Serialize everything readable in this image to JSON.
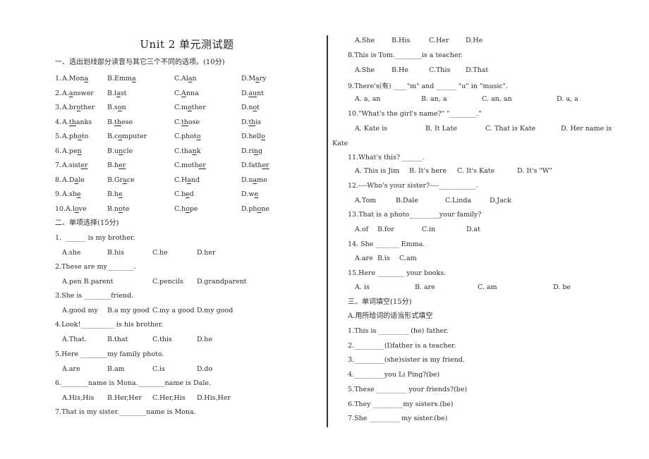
{
  "title": "Unit  2 单元测试题",
  "section1": {
    "heading": "一、选出划线部分读音与其它三个不同的选项。(10分)",
    "rows": [
      {
        "num": "1.",
        "options": [
          {
            "label": "A.",
            "pre": "Mon",
            "u": "a",
            "post": ""
          },
          {
            "label": "B.",
            "pre": "Emm",
            "u": "a",
            "post": ""
          },
          {
            "label": "C.",
            "pre": "Al",
            "u": "a",
            "post": "n"
          },
          {
            "label": "D.",
            "pre": "M",
            "u": "a",
            "post": "ry"
          }
        ]
      },
      {
        "num": "2.",
        "options": [
          {
            "label": "A.",
            "pre": "",
            "u": "a",
            "post": "nswer"
          },
          {
            "label": "B.",
            "pre": "l",
            "u": "a",
            "post": "st"
          },
          {
            "label": "C.",
            "pre": "",
            "u": "A",
            "post": "nna"
          },
          {
            "label": "D.",
            "pre": "",
            "u": "au",
            "post": "nt"
          }
        ]
      },
      {
        "num": "3.",
        "options": [
          {
            "label": "A.",
            "pre": "br",
            "u": "o",
            "post": "ther"
          },
          {
            "label": "B.",
            "pre": "s",
            "u": "o",
            "post": "n"
          },
          {
            "label": "C.",
            "pre": "m",
            "u": "o",
            "post": "ther"
          },
          {
            "label": "D.",
            "pre": "n",
            "u": "o",
            "post": "t"
          }
        ]
      },
      {
        "num": "4.",
        "options": [
          {
            "label": "A.",
            "pre": "",
            "u": "th",
            "post": "anks"
          },
          {
            "label": "B.",
            "pre": "",
            "u": "th",
            "post": "ese"
          },
          {
            "label": "C.",
            "pre": "",
            "u": "th",
            "post": "ose"
          },
          {
            "label": "D.",
            "pre": "",
            "u": "th",
            "post": "is"
          }
        ]
      },
      {
        "num": "5.",
        "options": [
          {
            "label": "A.",
            "pre": "ph",
            "u": "o",
            "post": "to"
          },
          {
            "label": "B.",
            "pre": "c",
            "u": "o",
            "post": "mputer"
          },
          {
            "label": "C.",
            "pre": "phot",
            "u": "o",
            "post": ""
          },
          {
            "label": "D.",
            "pre": "hell",
            "u": "o",
            "post": ""
          }
        ]
      },
      {
        "num": "6.",
        "options": [
          {
            "label": "A.",
            "pre": "pe",
            "u": "n",
            "post": ""
          },
          {
            "label": "B.",
            "pre": "u",
            "u": "n",
            "post": "cle"
          },
          {
            "label": "C.",
            "pre": "tha",
            "u": "n",
            "post": "k"
          },
          {
            "label": "D.",
            "pre": "ri",
            "u": "n",
            "post": "g"
          }
        ]
      },
      {
        "num": "7.",
        "options": [
          {
            "label": "A.",
            "pre": "sist",
            "u": "er",
            "post": ""
          },
          {
            "label": "B.",
            "pre": "h",
            "u": "er",
            "post": ""
          },
          {
            "label": "C.",
            "pre": "moth",
            "u": "er",
            "post": ""
          },
          {
            "label": "D.",
            "pre": "fath",
            "u": "er",
            "post": ""
          }
        ]
      },
      {
        "num": "8.",
        "options": [
          {
            "label": "A.",
            "pre": "D",
            "u": "a",
            "post": "le"
          },
          {
            "label": "B.",
            "pre": "Gr",
            "u": "a",
            "post": "ce"
          },
          {
            "label": "C.",
            "pre": "H",
            "u": "a",
            "post": "nd"
          },
          {
            "label": "D.",
            "pre": "n",
            "u": "a",
            "post": "me"
          }
        ]
      },
      {
        "num": "9.",
        "options": [
          {
            "label": "A.",
            "pre": "sh",
            "u": "e",
            "post": ""
          },
          {
            "label": "B.",
            "pre": "h",
            "u": "e",
            "post": ""
          },
          {
            "label": "C.",
            "pre": "b",
            "u": "e",
            "post": "d"
          },
          {
            "label": "D.",
            "pre": "w",
            "u": "e",
            "post": ""
          }
        ]
      },
      {
        "num": "10.",
        "options": [
          {
            "label": "A.",
            "pre": "l",
            "u": "o",
            "post": "ve"
          },
          {
            "label": "B.",
            "pre": "n",
            "u": "o",
            "post": "te"
          },
          {
            "label": "C.",
            "pre": "h",
            "u": "o",
            "post": "pe"
          },
          {
            "label": "D.",
            "pre": "ph",
            "u": "o",
            "post": "ne"
          }
        ]
      }
    ]
  },
  "section2": {
    "heading": "二、单项选择(15分)",
    "questions": [
      {
        "q": "1.  ______ is my brother.",
        "opts": [
          "A.she",
          "B.his",
          "C.he",
          "D.her"
        ]
      },
      {
        "q": "2.These are my________.",
        "opts": [
          "A.pen B.parent",
          "C.pencils",
          "D.grandparent"
        ]
      },
      {
        "q": "3.She is ________friend.",
        "opts": [
          "A.good my",
          "B.a my good",
          "C.my a good",
          "D.my good"
        ]
      },
      {
        "q": "4.Look!__________ is his brother.",
        "opts": [
          "A.That.",
          "B.that",
          "C.this",
          "D.he"
        ]
      },
      {
        "q": "5.Here ________my family photo.",
        "opts": [
          "A.are",
          "B.am",
          "C.is",
          "D.do"
        ]
      },
      {
        "q": "6.________name is Mona.________name is Dale.",
        "opts": [
          "A.His,His",
          "B.Her,Her",
          "C.Her,His",
          "D.His,Her"
        ]
      },
      {
        "q": "7.That is my sister.________name is Mona.",
        "opts": [
          "A.She",
          "B.His",
          "C.Her",
          "D.He"
        ]
      },
      {
        "q": "8.This is Tom.________is a teacher.",
        "opts": [
          "A.She",
          "B.He",
          "C.This",
          "D.That"
        ]
      },
      {
        "q": "9.There's(有) ____\"m\" and ______ \"u\" in \"music\".",
        "opts": [
          "A. a, an",
          "B. an, a",
          "C. an, an",
          "D. a, a"
        ]
      },
      {
        "q": "10.\"What's the girl's name?\" \"________.\"",
        "opts": [
          "A. Kate is",
          "B. It Late",
          "C. That is Kate",
          "D. Her name is"
        ],
        "wrap": "Kate"
      },
      {
        "q": "11.What's this? ______.",
        "opts": [
          "A. This is Jim",
          "B. It's here",
          "C. It's Kate",
          "D. It's \"W\""
        ]
      },
      {
        "q": "12.----Who's your sister?----___________.",
        "opts": [
          "A.Tom",
          "B.Dale",
          "C.Linda",
          "D.Jack"
        ]
      },
      {
        "q": "13.That is a photo_________your family?",
        "opts": [
          "A.of",
          "B.for",
          "C.in",
          "D.at"
        ]
      },
      {
        "q": "14. She _______ Emma.",
        "opts": [
          "A.are",
          "B.is",
          "C.am"
        ]
      },
      {
        "q": "15.Here ________ your books.",
        "opts": [
          "A. is",
          "B. are",
          "C. am",
          "D. be"
        ]
      }
    ]
  },
  "section3": {
    "heading": "三、单词填空(15分)",
    "subheading": "A.用所给词的适当形式填空",
    "items": [
      "1.This is _________ (he) father.",
      "2._________(I)father is a teacher.",
      "3._________(she)sister is my friend.",
      "4._________you Li Ping?(be)",
      "5.These _________ your friends?(be)",
      "6.They _________my sisters.(be)",
      "7.She _________ my sister.(be)"
    ]
  }
}
